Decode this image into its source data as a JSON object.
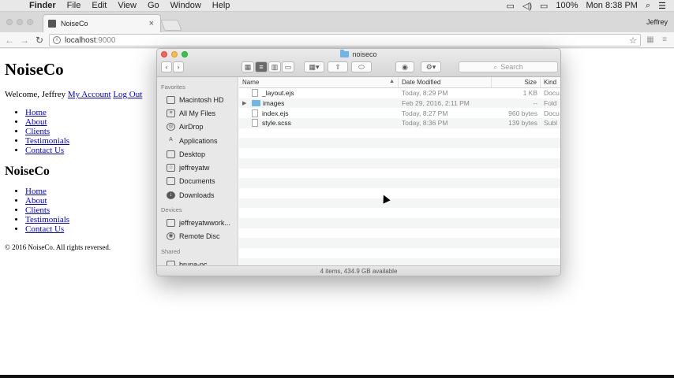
{
  "menubar": {
    "app": "Finder",
    "items": [
      "File",
      "Edit",
      "View",
      "Go",
      "Window",
      "Help"
    ],
    "battery": "100%",
    "clock": "Mon 8:38 PM"
  },
  "browser": {
    "tab_title": "NoiseCo",
    "profile": "Jeffrey",
    "url_host": "localhost",
    "url_port": ":9000"
  },
  "page": {
    "title": "NoiseCo",
    "welcome": "Welcome, Jeffrey",
    "my_account": "My Account",
    "log_out": "Log Out",
    "nav": [
      "Home",
      "About",
      "Clients",
      "Testimonials",
      "Contact Us"
    ],
    "subtitle": "NoiseCo",
    "nav2": [
      "Home",
      "About",
      "Clients",
      "Testimonials",
      "Contact Us"
    ],
    "footer": "© 2016 NoiseCo. All rights reversed."
  },
  "finder": {
    "title": "noiseco",
    "search_placeholder": "Search",
    "sidebar": {
      "favorites_label": "Favorites",
      "favorites": [
        "Macintosh HD",
        "All My Files",
        "AirDrop",
        "Applications",
        "Desktop",
        "jeffreyatw",
        "Documents",
        "Downloads"
      ],
      "devices_label": "Devices",
      "devices": [
        "jeffreyatwwork...",
        "Remote Disc"
      ],
      "shared_label": "Shared",
      "shared": [
        "bruna-pc"
      ]
    },
    "columns": {
      "name": "Name",
      "date": "Date Modified",
      "size": "Size",
      "kind": "Kind"
    },
    "files": [
      {
        "name": "_layout.ejs",
        "date": "Today, 8:29 PM",
        "size": "1 KB",
        "kind": "Docu"
      },
      {
        "name": "images",
        "date": "Feb 29, 2016, 2:11 PM",
        "size": "--",
        "kind": "Fold"
      },
      {
        "name": "index.ejs",
        "date": "Today, 8:27 PM",
        "size": "960 bytes",
        "kind": "Docu"
      },
      {
        "name": "style.scss",
        "date": "Today, 8:36 PM",
        "size": "139 bytes",
        "kind": "Subl"
      }
    ],
    "status": "4 items, 434.9 GB available"
  }
}
